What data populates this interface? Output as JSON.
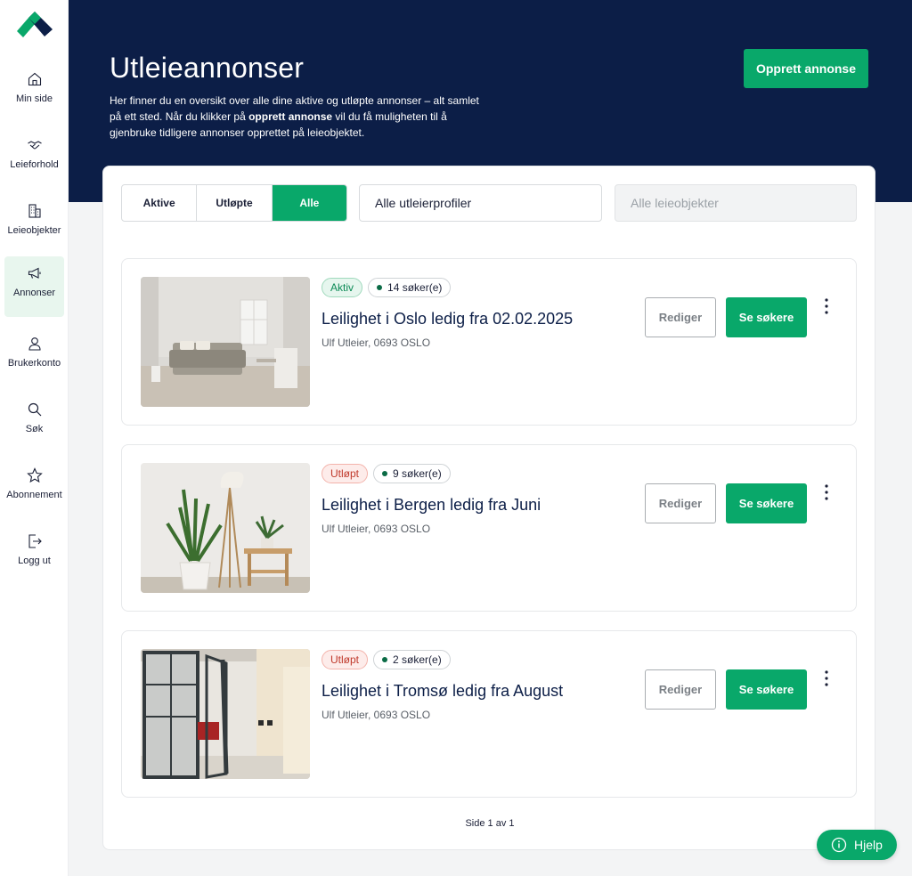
{
  "colors": {
    "navy": "#0c1e47",
    "green": "#09a86a",
    "active_nav_bg": "#e8f6ee"
  },
  "sidebar": {
    "items": [
      {
        "label": "Min side",
        "icon": "home-icon"
      },
      {
        "label": "Leieforhold",
        "icon": "handshake-icon"
      },
      {
        "label": "Leieobjekter",
        "icon": "building-icon"
      },
      {
        "label": "Annonser",
        "icon": "megaphone-icon",
        "active": true
      },
      {
        "label": "Brukerkonto",
        "icon": "user-icon"
      },
      {
        "label": "Søk",
        "icon": "search-icon"
      },
      {
        "label": "Abonnement",
        "icon": "star-icon"
      },
      {
        "label": "Logg ut",
        "icon": "logout-icon"
      }
    ]
  },
  "header": {
    "title": "Utleieannonser",
    "desc_part1": "Her finner du en oversikt over alle dine aktive og utløpte annonser – alt samlet på ett sted. Når du klikker på ",
    "desc_bold": "opprett annonse",
    "desc_part2": " vil du få muligheten til å gjenbruke tidligere annonser opprettet på leieobjektet.",
    "create_button": "Opprett annonse"
  },
  "filters": {
    "tabs": [
      {
        "label": "Aktive",
        "selected": false
      },
      {
        "label": "Utløpte",
        "selected": false
      },
      {
        "label": "Alle",
        "selected": true
      }
    ],
    "profiles_value": "Alle utleierprofiler",
    "objects_placeholder": "Alle leieobjekter"
  },
  "listings": [
    {
      "status": "Aktiv",
      "status_type": "active",
      "applicants": "14 søker(e)",
      "title": "Leilighet i Oslo ledig fra 02.02.2025",
      "subtitle": "Ulf Utleier, 0693 OSLO",
      "edit_label": "Rediger",
      "view_label": "Se søkere"
    },
    {
      "status": "Utløpt",
      "status_type": "expired",
      "applicants": "9 søker(e)",
      "title": "Leilighet i Bergen ledig fra Juni",
      "subtitle": "Ulf Utleier, 0693 OSLO",
      "edit_label": "Rediger",
      "view_label": "Se søkere"
    },
    {
      "status": "Utløpt",
      "status_type": "expired",
      "applicants": "2 søker(e)",
      "title": "Leilighet i Tromsø ledig fra August",
      "subtitle": "Ulf Utleier, 0693 OSLO",
      "edit_label": "Rediger",
      "view_label": "Se søkere"
    }
  ],
  "pagination": "Side 1 av 1",
  "help_button": "Hjelp"
}
